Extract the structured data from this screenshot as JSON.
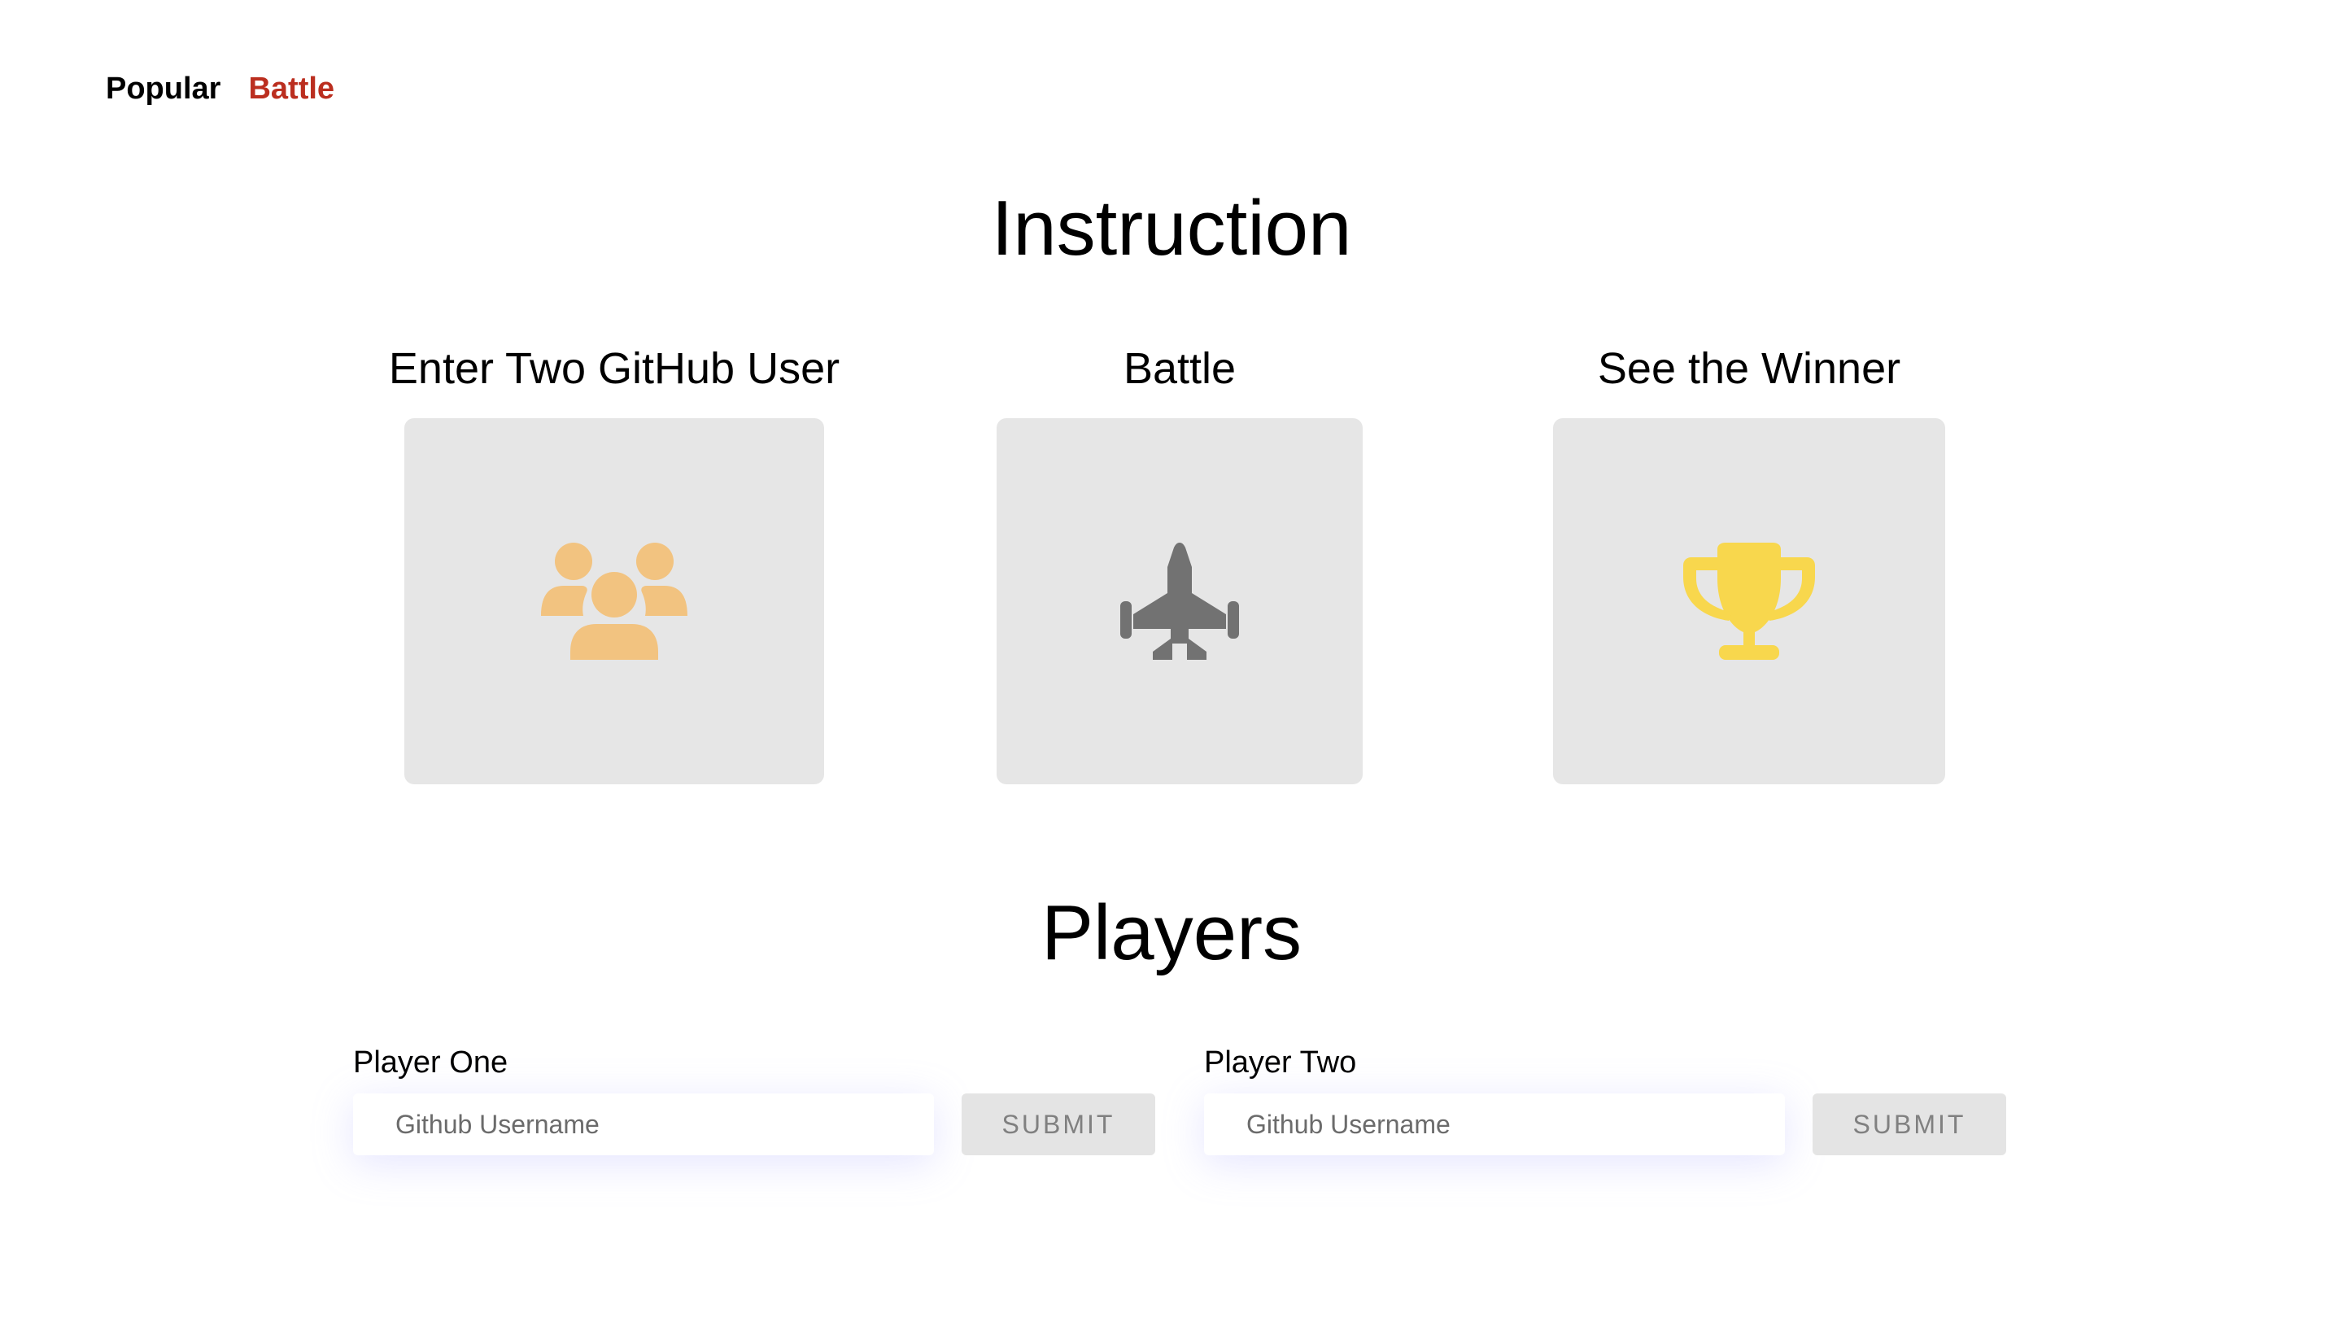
{
  "nav": {
    "items": [
      {
        "label": "Popular"
      },
      {
        "label": "Battle"
      }
    ]
  },
  "instruction": {
    "title": "Instruction",
    "steps": [
      {
        "label": "Enter Two GitHub User",
        "icon": "users-icon",
        "color": "#f2c380"
      },
      {
        "label": "Battle",
        "icon": "fighter-jet-icon",
        "color": "#727272"
      },
      {
        "label": "See the Winner",
        "icon": "trophy-icon",
        "color": "#f8d74d"
      }
    ]
  },
  "players": {
    "title": "Players",
    "player_one": {
      "label": "Player One",
      "placeholder": "Github Username",
      "value": "",
      "submit_label": "SUBMIT"
    },
    "player_two": {
      "label": "Player Two",
      "placeholder": "Github Username",
      "value": "",
      "submit_label": "SUBMIT"
    }
  },
  "colors": {
    "active_nav": "#bb2e1f",
    "card_background": "#e6e6e6",
    "button_background": "#e4e4e4"
  }
}
